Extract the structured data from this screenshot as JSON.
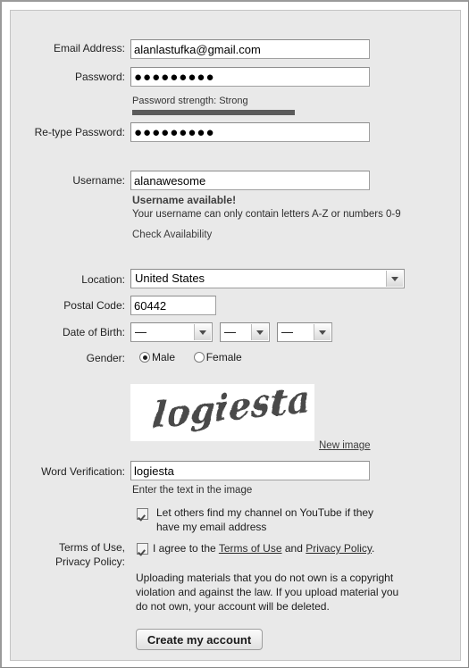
{
  "form": {
    "email": {
      "label": "Email Address:",
      "value": "alanlastufka@gmail.com",
      "placeholder": ""
    },
    "password": {
      "label": "Password:",
      "value": "●●●●●●●●●",
      "placeholder": "",
      "strength_label": "Password strength: Strong",
      "strength_value": "Strong",
      "strength_percent": 68
    },
    "retype_password": {
      "label": "Re-type Password:",
      "value": "●●●●●●●●●",
      "placeholder": ""
    },
    "username": {
      "label": "Username:",
      "value": "alanawesome",
      "placeholder": "",
      "availability_message": "Username available!",
      "hint": "Your username can only contain letters A-Z or numbers 0-9",
      "check_link": "Check Availability"
    },
    "location": {
      "label": "Location:",
      "value": "United States"
    },
    "postal_code": {
      "label": "Postal Code:",
      "value": "60442",
      "placeholder": ""
    },
    "date_of_birth": {
      "label": "Date of Birth:",
      "month": "—",
      "day": "—",
      "year": "—"
    },
    "gender": {
      "label": "Gender:",
      "male_label": "Male",
      "female_label": "Female",
      "selected": "Male"
    },
    "captcha": {
      "image_text": "logiesta",
      "new_image_link": "New image"
    },
    "word_verification": {
      "label": "Word Verification:",
      "value": "logiesta",
      "placeholder": "",
      "hint": "Enter the text in the image"
    },
    "find_channel": {
      "label": "Let others find my channel on YouTube if they have my email address",
      "checked": true
    },
    "terms": {
      "label_line1": "Terms of Use,",
      "label_line2": "Privacy Policy:",
      "checked": true,
      "agree_prefix": "I agree to the ",
      "terms_link": "Terms of Use",
      "agree_middle": " and ",
      "privacy_link": "Privacy Policy",
      "agree_suffix": ".",
      "copyright_notice": "Uploading materials that you do not own is a copyright violation and against the law. If you upload material you do not own, your account will be deleted."
    },
    "submit": {
      "label": "Create my account"
    }
  },
  "colors": {
    "panel_bg": "#e9e9e9",
    "page_bg": "#ffffff",
    "strength_bar": "#5b5b5b",
    "text": "#1a1a1a"
  }
}
